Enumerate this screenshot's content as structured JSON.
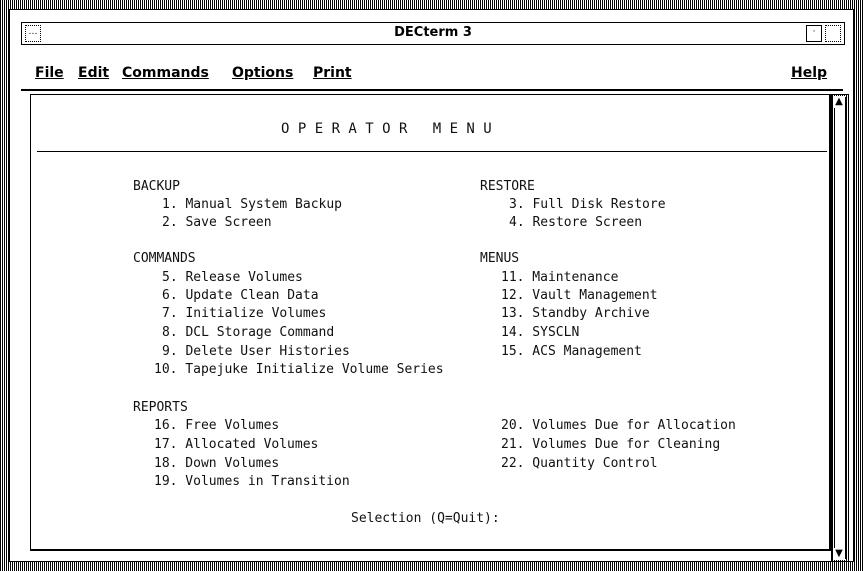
{
  "window": {
    "title": "DECterm 3"
  },
  "menubar": {
    "file": "File",
    "edit": "Edit",
    "commands": "Commands",
    "options": "Options",
    "print": "Print",
    "help": "Help"
  },
  "screen": {
    "heading": "O P E R A T O R   M E N U",
    "backup": {
      "header": "BACKUP",
      "items": [
        "1. Manual System Backup",
        "2. Save Screen"
      ]
    },
    "restore": {
      "header": "RESTORE",
      "items": [
        "3. Full Disk Restore",
        "4. Restore Screen"
      ]
    },
    "commands": {
      "header": "COMMANDS",
      "items": [
        "5. Release Volumes",
        "6. Update Clean Data",
        "7. Initialize Volumes",
        "8. DCL Storage Command",
        "9. Delete User Histories",
        "10. Tapejuke Initialize Volume Series"
      ]
    },
    "menus": {
      "header": "MENUS",
      "items": [
        "11. Maintenance",
        "12. Vault Management",
        "13. Standby Archive",
        "14. SYSCLN",
        "15. ACS Management"
      ]
    },
    "reports": {
      "header": "REPORTS",
      "left_items": [
        "16. Free Volumes",
        "17. Allocated Volumes",
        "18. Down Volumes",
        "19. Volumes in Transition"
      ],
      "right_items": [
        "20. Volumes Due for Allocation",
        "21. Volumes Due for Cleaning",
        "22. Quantity Control"
      ]
    },
    "prompt": "Selection (Q=Quit):"
  }
}
